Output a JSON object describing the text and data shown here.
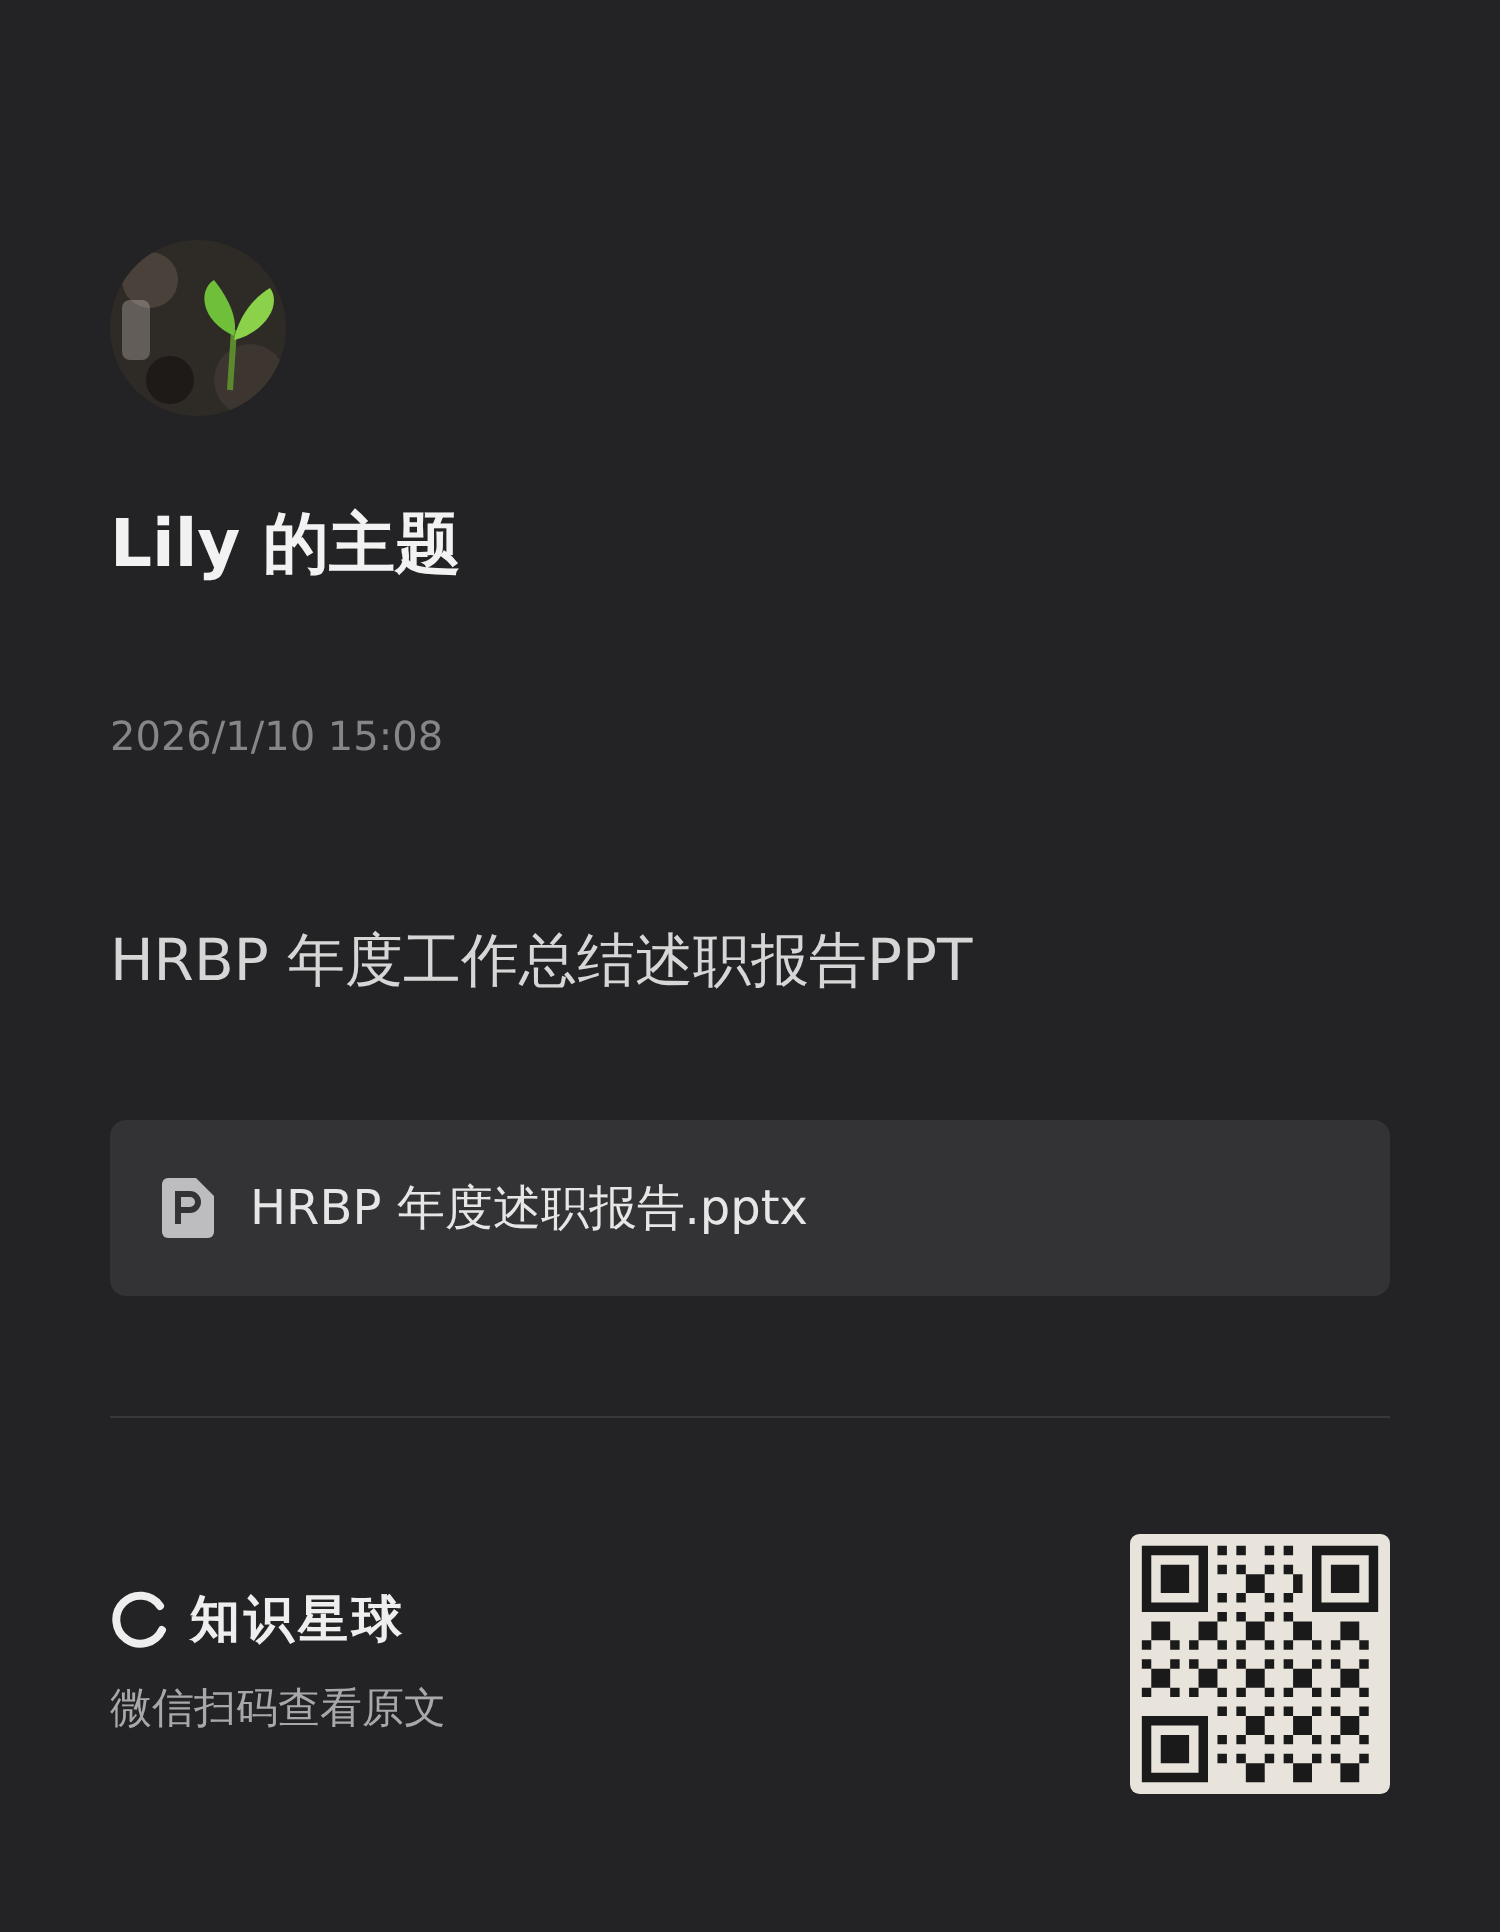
{
  "title": "Lily 的主题",
  "date": "2026/1/10 15:08",
  "content": "HRBP 年度工作总结述职报告PPT",
  "attachment": {
    "file_name": "HRBP 年度述职报告.pptx"
  },
  "footer": {
    "brand": "知识星球",
    "hint": "微信扫码查看原文"
  }
}
